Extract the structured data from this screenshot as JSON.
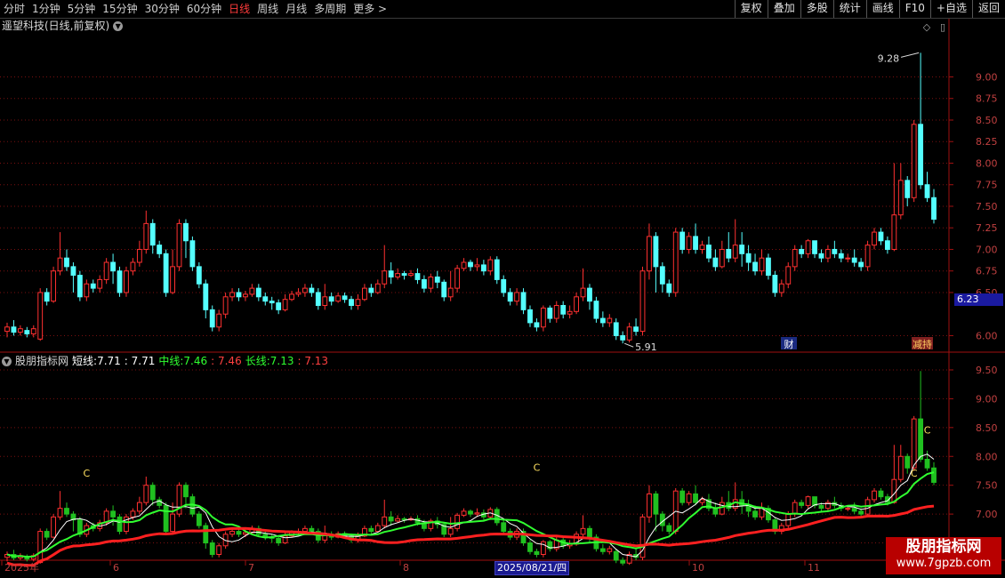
{
  "toolbar": {
    "periods": [
      "分时",
      "1分钟",
      "5分钟",
      "15分钟",
      "30分钟",
      "60分钟",
      "日线",
      "周线",
      "月线",
      "多周期",
      "更多 >"
    ],
    "active_period": "日线",
    "buttons": [
      "复权",
      "叠加",
      "多股",
      "统计",
      "画线",
      "F10",
      "+自选",
      "返回"
    ]
  },
  "stock_title": "遥望科技(日线,前复权)",
  "chart_controls": {
    "diamond_icon": "◇",
    "toggle_icon": "▯"
  },
  "main_axis": {
    "ticks": [
      "9.00",
      "8.75",
      "8.50",
      "8.25",
      "8.00",
      "7.75",
      "7.50",
      "7.25",
      "7.00",
      "6.75",
      "6.50",
      "6.23",
      "6.00"
    ],
    "current_price": "6.23",
    "high_label": "9.28",
    "low_label": "5.91",
    "event_marks": [
      "财",
      "减持"
    ]
  },
  "indicator": {
    "name": "股朋指标网",
    "short_label": "短线:",
    "short_v1": "7.71",
    "short_v2": ": 7.71",
    "mid_label": "中线:",
    "mid_v1": "7.46",
    "mid_v2": ": 7.46",
    "long_label": "长线:",
    "long_v1": "7.13",
    "long_v2": ": 7.13",
    "ticks": [
      "9.50",
      "9.00",
      "8.50",
      "8.00",
      "7.50",
      "7.00",
      "6.50"
    ],
    "c_markers": [
      "C",
      "C",
      "C",
      "C"
    ]
  },
  "time_axis": {
    "labels": [
      "2025年",
      "6",
      "7",
      "8",
      "10",
      "11"
    ],
    "cursor_date": "2025/08/21/四"
  },
  "watermark": {
    "title": "股朋指标网",
    "url": "www.7gpzb.com"
  },
  "colors": {
    "up": "#ff3030",
    "down": "#54ffff",
    "short": "#ffffff",
    "mid": "#30ff30",
    "long": "#ff2020",
    "grid": "#7a1010"
  },
  "chart_data": {
    "type": "candlestick",
    "title": "遥望科技(日线,前复权)",
    "y_range": [
      5.85,
      9.5
    ],
    "candles": [
      [
        6.05,
        6.1,
        5.98,
        6.15
      ],
      [
        6.1,
        6.04,
        6.0,
        6.18
      ],
      [
        6.04,
        6.08,
        6.0,
        6.12
      ],
      [
        6.06,
        6.02,
        5.98,
        6.1
      ],
      [
        6.02,
        6.08,
        5.98,
        6.12
      ],
      [
        5.96,
        6.5,
        5.94,
        6.55
      ],
      [
        6.5,
        6.4,
        6.35,
        6.55
      ],
      [
        6.4,
        6.75,
        6.38,
        6.8
      ],
      [
        6.75,
        6.9,
        6.7,
        7.2
      ],
      [
        6.9,
        6.8,
        6.75,
        7.0
      ],
      [
        6.8,
        6.7,
        6.5,
        6.85
      ],
      [
        6.7,
        6.45,
        6.4,
        6.75
      ],
      [
        6.45,
        6.6,
        6.4,
        6.65
      ],
      [
        6.6,
        6.55,
        6.5,
        6.65
      ],
      [
        6.55,
        6.65,
        6.5,
        6.7
      ],
      [
        6.65,
        6.85,
        6.6,
        6.9
      ],
      [
        6.85,
        6.75,
        6.6,
        6.95
      ],
      [
        6.75,
        6.5,
        6.45,
        6.8
      ],
      [
        6.5,
        6.75,
        6.45,
        6.8
      ],
      [
        6.75,
        6.85,
        6.7,
        6.9
      ],
      [
        6.85,
        7.0,
        6.8,
        7.1
      ],
      [
        7.0,
        7.3,
        6.95,
        7.45
      ],
      [
        7.3,
        7.05,
        6.95,
        7.35
      ],
      [
        7.05,
        6.95,
        6.9,
        7.1
      ],
      [
        6.95,
        6.5,
        6.45,
        7.0
      ],
      [
        6.5,
        6.8,
        6.48,
        7.0
      ],
      [
        6.8,
        7.3,
        6.75,
        7.35
      ],
      [
        7.3,
        7.1,
        6.9,
        7.35
      ],
      [
        7.1,
        6.8,
        6.75,
        7.15
      ],
      [
        6.8,
        6.6,
        6.55,
        6.85
      ],
      [
        6.6,
        6.3,
        6.2,
        6.65
      ],
      [
        6.3,
        6.1,
        6.05,
        6.35
      ],
      [
        6.1,
        6.25,
        6.05,
        6.3
      ],
      [
        6.25,
        6.45,
        6.2,
        6.5
      ],
      [
        6.45,
        6.5,
        6.4,
        6.55
      ],
      [
        6.5,
        6.45,
        6.4,
        6.55
      ],
      [
        6.45,
        6.48,
        6.4,
        6.52
      ],
      [
        6.48,
        6.55,
        6.45,
        6.6
      ],
      [
        6.55,
        6.45,
        6.4,
        6.6
      ],
      [
        6.45,
        6.4,
        6.35,
        6.5
      ],
      [
        6.4,
        6.38,
        6.3,
        6.45
      ],
      [
        6.38,
        6.3,
        6.25,
        6.42
      ],
      [
        6.3,
        6.42,
        6.28,
        6.48
      ],
      [
        6.42,
        6.48,
        6.4,
        6.52
      ],
      [
        6.48,
        6.5,
        6.45,
        6.55
      ],
      [
        6.5,
        6.55,
        6.45,
        6.6
      ],
      [
        6.55,
        6.5,
        6.45,
        6.6
      ],
      [
        6.5,
        6.35,
        6.3,
        6.55
      ],
      [
        6.35,
        6.45,
        6.3,
        6.6
      ],
      [
        6.45,
        6.4,
        6.35,
        6.5
      ],
      [
        6.4,
        6.46,
        6.38,
        6.5
      ],
      [
        6.46,
        6.42,
        6.38,
        6.5
      ],
      [
        6.42,
        6.35,
        6.3,
        6.46
      ],
      [
        6.35,
        6.42,
        6.3,
        6.48
      ],
      [
        6.42,
        6.55,
        6.4,
        6.6
      ],
      [
        6.55,
        6.5,
        6.45,
        6.6
      ],
      [
        6.5,
        6.6,
        6.48,
        6.65
      ],
      [
        6.6,
        6.75,
        6.55,
        7.05
      ],
      [
        6.75,
        6.68,
        6.6,
        6.85
      ],
      [
        6.68,
        6.72,
        6.65,
        6.78
      ],
      [
        6.72,
        6.7,
        6.65,
        6.75
      ],
      [
        6.7,
        6.72,
        6.68,
        6.76
      ],
      [
        6.72,
        6.65,
        6.6,
        6.78
      ],
      [
        6.65,
        6.55,
        6.5,
        6.7
      ],
      [
        6.55,
        6.68,
        6.5,
        6.72
      ],
      [
        6.68,
        6.62,
        6.55,
        6.75
      ],
      [
        6.62,
        6.45,
        6.4,
        6.65
      ],
      [
        6.45,
        6.55,
        6.4,
        6.75
      ],
      [
        6.55,
        6.78,
        6.5,
        6.82
      ],
      [
        6.78,
        6.85,
        6.75,
        6.9
      ],
      [
        6.85,
        6.8,
        6.75,
        6.88
      ],
      [
        6.8,
        6.82,
        6.75,
        6.9
      ],
      [
        6.82,
        6.75,
        6.7,
        6.88
      ],
      [
        6.75,
        6.88,
        6.7,
        6.92
      ],
      [
        6.88,
        6.65,
        6.6,
        6.92
      ],
      [
        6.65,
        6.5,
        6.45,
        6.7
      ],
      [
        6.5,
        6.4,
        6.35,
        6.55
      ],
      [
        6.4,
        6.5,
        6.35,
        6.55
      ],
      [
        6.5,
        6.3,
        6.25,
        6.55
      ],
      [
        6.3,
        6.15,
        6.1,
        6.35
      ],
      [
        6.15,
        6.1,
        6.05,
        6.2
      ],
      [
        6.1,
        6.32,
        6.05,
        6.35
      ],
      [
        6.32,
        6.2,
        6.15,
        6.35
      ],
      [
        6.2,
        6.35,
        6.15,
        6.4
      ],
      [
        6.35,
        6.25,
        6.2,
        6.4
      ],
      [
        6.25,
        6.28,
        6.2,
        6.35
      ],
      [
        6.28,
        6.45,
        6.25,
        6.5
      ],
      [
        6.45,
        6.55,
        6.4,
        6.78
      ],
      [
        6.55,
        6.4,
        6.3,
        6.6
      ],
      [
        6.4,
        6.2,
        6.15,
        6.45
      ],
      [
        6.2,
        6.15,
        6.1,
        6.28
      ],
      [
        6.15,
        6.2,
        6.1,
        6.25
      ],
      [
        6.15,
        6.0,
        5.95,
        6.2
      ],
      [
        6.0,
        5.95,
        5.91,
        6.05
      ],
      [
        5.95,
        6.1,
        5.92,
        6.15
      ],
      [
        6.1,
        6.05,
        6.0,
        6.2
      ],
      [
        6.05,
        6.75,
        6.0,
        6.8
      ],
      [
        6.75,
        7.15,
        6.65,
        7.3
      ],
      [
        7.15,
        6.8,
        6.5,
        7.2
      ],
      [
        6.8,
        6.6,
        6.5,
        6.85
      ],
      [
        6.6,
        6.5,
        6.45,
        6.65
      ],
      [
        6.5,
        7.2,
        6.45,
        7.25
      ],
      [
        7.2,
        7.0,
        6.95,
        7.25
      ],
      [
        7.0,
        7.15,
        6.95,
        7.2
      ],
      [
        7.15,
        7.0,
        6.95,
        7.3
      ],
      [
        7.0,
        7.05,
        6.95,
        7.1
      ],
      [
        7.05,
        6.9,
        6.85,
        7.15
      ],
      [
        6.9,
        6.8,
        6.75,
        7.0
      ],
      [
        6.8,
        7.0,
        6.78,
        7.1
      ],
      [
        7.0,
        6.9,
        6.85,
        7.2
      ],
      [
        6.9,
        7.05,
        6.85,
        7.35
      ],
      [
        7.05,
        6.95,
        6.8,
        7.2
      ],
      [
        6.95,
        6.85,
        6.75,
        7.05
      ],
      [
        6.85,
        6.75,
        6.7,
        6.95
      ],
      [
        6.75,
        6.9,
        6.7,
        7.0
      ],
      [
        6.9,
        6.7,
        6.65,
        6.95
      ],
      [
        6.7,
        6.5,
        6.45,
        6.75
      ],
      [
        6.5,
        6.6,
        6.45,
        6.65
      ],
      [
        6.6,
        6.8,
        6.55,
        6.85
      ],
      [
        6.8,
        7.0,
        6.75,
        7.05
      ],
      [
        7.0,
        6.95,
        6.9,
        7.05
      ],
      [
        6.95,
        7.1,
        6.9,
        7.12
      ],
      [
        7.1,
        6.95,
        6.9,
        7.1
      ],
      [
        6.95,
        6.9,
        6.85,
        7.0
      ],
      [
        6.9,
        7.0,
        6.85,
        7.05
      ],
      [
        7.0,
        6.95,
        6.9,
        7.1
      ],
      [
        6.95,
        6.9,
        6.85,
        7.0
      ],
      [
        6.9,
        6.9,
        6.85,
        6.95
      ],
      [
        6.9,
        6.85,
        6.8,
        7.0
      ],
      [
        6.85,
        6.8,
        6.75,
        6.9
      ],
      [
        6.8,
        7.05,
        6.75,
        7.1
      ],
      [
        7.05,
        7.2,
        7.0,
        7.25
      ],
      [
        7.2,
        7.1,
        7.05,
        7.25
      ],
      [
        7.1,
        7.0,
        6.95,
        7.15
      ],
      [
        7.0,
        7.4,
        6.98,
        8.0
      ],
      [
        7.4,
        7.8,
        7.35,
        8.0
      ],
      [
        7.8,
        7.6,
        7.5,
        7.85
      ],
      [
        7.6,
        8.45,
        7.55,
        8.5
      ],
      [
        8.45,
        7.75,
        7.7,
        9.28
      ],
      [
        7.75,
        7.6,
        7.55,
        7.9
      ],
      [
        7.6,
        7.35,
        7.3,
        7.7
      ]
    ]
  }
}
